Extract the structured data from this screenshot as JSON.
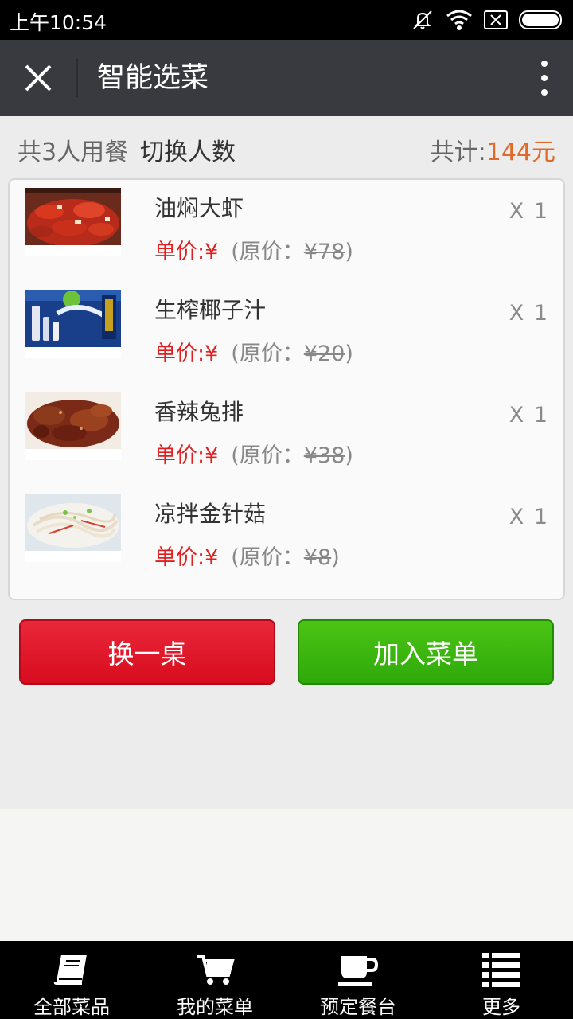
{
  "status": {
    "time": "上午10:54"
  },
  "header": {
    "title": "智能选菜"
  },
  "summary": {
    "diners": "共3人用餐",
    "switch_label": "切换人数",
    "total_label": "共计:",
    "total_amount": "144元"
  },
  "dishes": [
    {
      "name": "油焖大虾",
      "price_label": "单价:¥",
      "orig_prefix": "(原价：",
      "orig_price": "¥78",
      "orig_suffix": ")",
      "qty": "X 1"
    },
    {
      "name": "生榨椰子汁",
      "price_label": "单价:¥",
      "orig_prefix": "(原价：",
      "orig_price": "¥20",
      "orig_suffix": ")",
      "qty": "X 1"
    },
    {
      "name": "香辣兔排",
      "price_label": "单价:¥",
      "orig_prefix": "(原价：",
      "orig_price": "¥38",
      "orig_suffix": ")",
      "qty": "X 1"
    },
    {
      "name": "凉拌金针菇",
      "price_label": "单价:¥",
      "orig_prefix": "(原价：",
      "orig_price": "¥8",
      "orig_suffix": ")",
      "qty": "X 1"
    }
  ],
  "actions": {
    "change_table": "换一桌",
    "add_to_menu": "加入菜单"
  },
  "nav": [
    {
      "label": "全部菜品",
      "icon": "book-icon"
    },
    {
      "label": "我的菜单",
      "icon": "cart-icon"
    },
    {
      "label": "预定餐台",
      "icon": "cup-icon"
    },
    {
      "label": "更多",
      "icon": "list-icon"
    }
  ],
  "colors": {
    "accent_orange": "#e06a2a",
    "price_red": "#e02020",
    "red_button": "#dc1424",
    "green_button": "#3cb810",
    "header_bg": "#393a3f"
  }
}
